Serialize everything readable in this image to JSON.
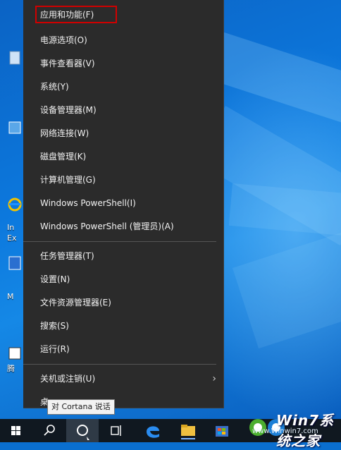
{
  "menu": {
    "items": [
      {
        "label": "应用和功能(F)"
      },
      {
        "label": "电源选项(O)"
      },
      {
        "label": "事件查看器(V)"
      },
      {
        "label": "系统(Y)"
      },
      {
        "label": "设备管理器(M)"
      },
      {
        "label": "网络连接(W)"
      },
      {
        "label": "磁盘管理(K)"
      },
      {
        "label": "计算机管理(G)"
      },
      {
        "label": "Windows PowerShell(I)"
      },
      {
        "label": "Windows PowerShell (管理员)(A)"
      },
      {
        "label": "任务管理器(T)"
      },
      {
        "label": "设置(N)"
      },
      {
        "label": "文件资源管理器(E)"
      },
      {
        "label": "搜索(S)"
      },
      {
        "label": "运行(R)"
      },
      {
        "label": "关机或注销(U)"
      },
      {
        "label": "桌"
      }
    ],
    "highlighted_item": "应用和功能(F)",
    "highlight_color": "#d00000"
  },
  "tooltip": {
    "text": "对 Cortana 说话"
  },
  "desktop": {
    "icon_labels": [
      "In",
      "Ex",
      "M",
      "腾"
    ]
  },
  "taskbar": {
    "buttons": [
      "start-icon",
      "search-icon",
      "cortana-icon",
      "task-view-icon",
      "edge-icon",
      "file-explorer-icon",
      "store-icon"
    ]
  },
  "watermark": {
    "brand": "Win7系统之家",
    "url": "www.Winwin7.com"
  }
}
